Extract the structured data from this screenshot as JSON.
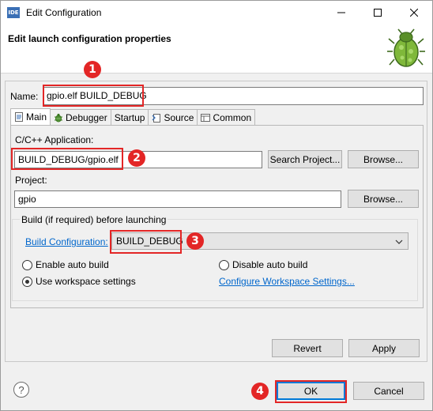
{
  "window": {
    "title": "Edit Configuration",
    "app_icon_text": "IDE"
  },
  "header": {
    "title": "Edit launch configuration properties"
  },
  "name_field": {
    "label": "Name:",
    "value": "gpio.elf BUILD_DEBUG"
  },
  "tabs": [
    {
      "label": "Main",
      "icon": "main-tab-icon"
    },
    {
      "label": "Debugger",
      "icon": "debugger-bug-icon"
    },
    {
      "label": "Startup",
      "icon": ""
    },
    {
      "label": "Source",
      "icon": "source-icon"
    },
    {
      "label": "Common",
      "icon": "common-icon"
    }
  ],
  "main": {
    "app_label": "C/C++ Application:",
    "app_value": "BUILD_DEBUG/gpio.elf",
    "search_project_button": "Search Project...",
    "browse_button_1": "Browse...",
    "project_label": "Project:",
    "project_value": "gpio",
    "browse_button_2": "Browse...",
    "build_group_title": "Build (if required) before launching",
    "build_config_link": "Build Configuration:",
    "build_config_value": "BUILD_DEBUG",
    "enable_auto_build": "Enable auto build",
    "disable_auto_build": "Disable auto build",
    "use_workspace_settings": "Use workspace settings",
    "configure_workspace_link": "Configure Workspace Settings...",
    "selected_option": "Use workspace settings"
  },
  "bottom": {
    "revert": "Revert",
    "apply": "Apply",
    "ok": "OK",
    "cancel": "Cancel",
    "help": "?"
  },
  "markers": [
    "1",
    "2",
    "3",
    "4"
  ],
  "colors": {
    "annotation_red": "#e32626",
    "link_blue": "#0066cc",
    "focus_blue": "#0078d7"
  }
}
